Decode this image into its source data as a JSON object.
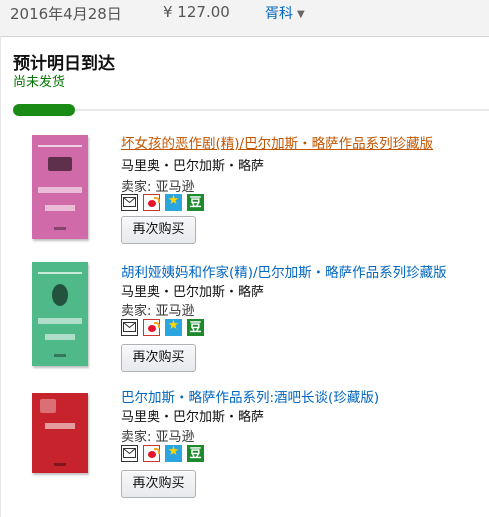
{
  "order": {
    "date": "2016年4月28日",
    "total": "¥ 127.00",
    "recipient": "胥科",
    "recipient_caret": "▼"
  },
  "delivery": {
    "title": "预计明日到达",
    "status": "尚未发货",
    "progress_fraction": 0.13,
    "progress_color": "#1a8c15"
  },
  "items": [
    {
      "title": "坏女孩的恶作剧(精)/巴尔加斯・略萨作品系列珍藏版",
      "author": "马里奥・巴尔加斯・略萨",
      "seller": "卖家: 亚马逊",
      "buy_again": "再次购买",
      "cover_color": "#d06aa8"
    },
    {
      "title": "胡利娅姨妈和作家(精)/巴尔加斯・略萨作品系列珍藏版",
      "author": "马里奥・巴尔加斯・略萨",
      "seller": "卖家: 亚马逊",
      "buy_again": "再次购买",
      "cover_color": "#4fb98a"
    },
    {
      "title": "巴尔加斯・略萨作品系列:酒吧长谈(珍藏版)",
      "author": "马里奥・巴尔加斯・略萨",
      "seller": "卖家: 亚马逊",
      "buy_again": "再次购买",
      "cover_color": "#c7232c"
    }
  ],
  "share_icons": [
    "mail-icon",
    "weibo-icon",
    "qzone-icon",
    "douban-icon"
  ],
  "share_douban_glyph": "豆",
  "share_qzone_glyph": "★",
  "colors": {
    "link": "#0066c0",
    "visited_link": "#c45500",
    "status_green": "#007600"
  }
}
